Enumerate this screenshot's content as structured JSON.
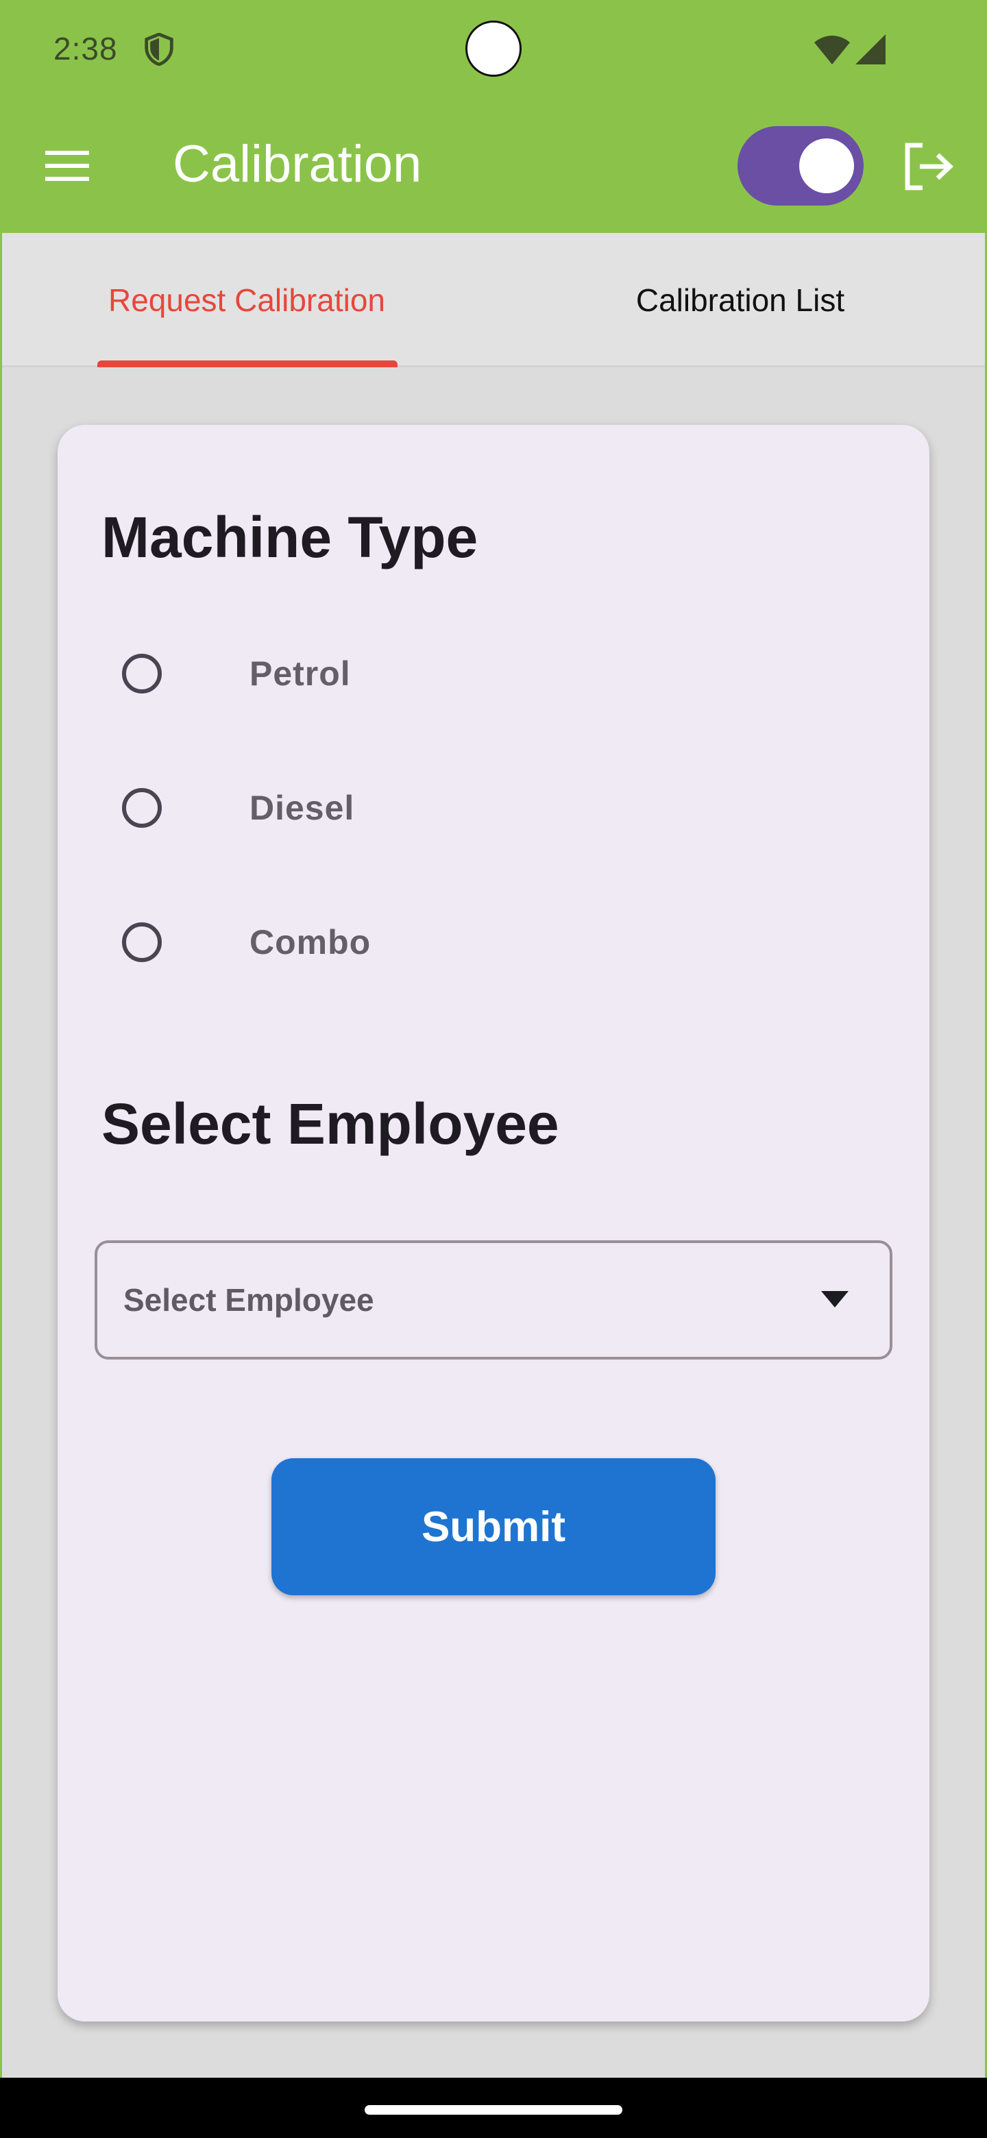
{
  "status_bar": {
    "time": "2:38",
    "icons": [
      "shield-icon",
      "wifi-icon",
      "signal-icon"
    ]
  },
  "app_bar": {
    "title": "Calibration",
    "menu_icon": "menu-icon",
    "toggle_on": true,
    "logout_icon": "logout-icon"
  },
  "tabs": [
    {
      "label": "Request Calibration",
      "active": true
    },
    {
      "label": "Calibration List",
      "active": false
    }
  ],
  "form": {
    "machine_type_title": "Machine Type",
    "machine_options": [
      {
        "label": "Petrol",
        "selected": false
      },
      {
        "label": "Diesel",
        "selected": false
      },
      {
        "label": "Combo",
        "selected": false
      }
    ],
    "employee_title": "Select Employee",
    "employee_dropdown": {
      "value": "Select Employee"
    },
    "submit_label": "Submit"
  },
  "colors": {
    "app_bar": "#8bc34a",
    "active_tab": "#e8463b",
    "toggle": "#6a4fa5",
    "card": "#efeaf4",
    "submit": "#1f74d1"
  }
}
